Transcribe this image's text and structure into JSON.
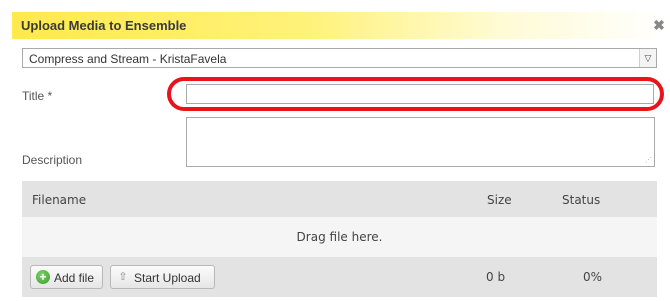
{
  "dialog": {
    "title": "Upload Media to Ensemble",
    "close_symbol": "✖"
  },
  "profile_select": {
    "selected": "Compress and Stream - KristaFavela",
    "arrow_symbol": "▽"
  },
  "form": {
    "title_label": "Title *",
    "title_value": "",
    "description_label": "Description",
    "description_value": ""
  },
  "upload_table": {
    "columns": [
      "Filename",
      "Size",
      "Status"
    ],
    "drop_text": "Drag file here.",
    "add_file_label": "Add file",
    "start_upload_label": "Start Upload",
    "total_size": "0 b",
    "total_status": "0%"
  },
  "icons": {
    "close": "close-icon",
    "dropdown": "chevron-down-icon",
    "add": "plus-circle-icon",
    "upload": "upload-arrow-icon"
  },
  "colors": {
    "title_bar_yellow": "#ffe94d",
    "highlight_red": "#e8131b",
    "add_icon_green": "#3a9a2b",
    "table_header_gray": "#e3e3e3"
  }
}
